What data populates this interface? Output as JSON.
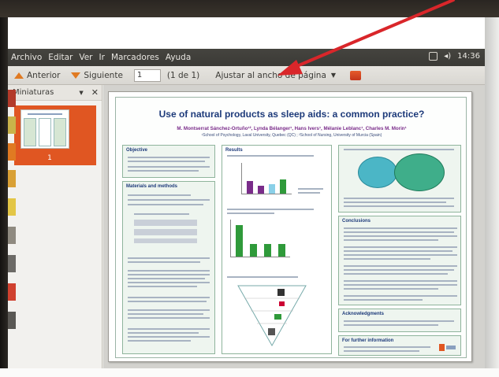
{
  "menubar": {
    "items": [
      "Archivo",
      "Editar",
      "Ver",
      "Ir",
      "Marcadores",
      "Ayuda"
    ],
    "clock": "14:36"
  },
  "toolbar": {
    "prev_label": "Anterior",
    "next_label": "Siguiente",
    "page_value": "1",
    "page_of": "(1 de 1)",
    "zoom_label": "Ajustar al ancho de página"
  },
  "sidebar": {
    "title": "Miniaturas",
    "thumbnail_page": "1"
  },
  "poster": {
    "title": "Use of natural products as sleep aids: a common practice?",
    "authors": "M. Montserrat Sánchez-Ortuño¹², Lynda Bélanger¹, Hans Ivers¹, Mélanie Leblanc¹, Charles M. Morin¹",
    "affiliations": "¹School of Psychology, Laval University, Quebec (QC) ; ²School of Nursing, University of Murcia (Spain)",
    "sections": {
      "objective": "Objective",
      "results": "Results",
      "materials": "Materials and methods",
      "conclusions": "Conclusions",
      "acknowledgments": "Acknowledgments",
      "further": "For further information"
    }
  },
  "colors": {
    "accent_orange": "#e05622",
    "annotation_arrow": "#d9262a",
    "poster_title": "#1d3a7a",
    "poster_authors": "#7a2c8a"
  },
  "icons": [
    "prev-arrow-icon",
    "next-arrow-icon",
    "bookmark-icon",
    "close-icon",
    "volume-icon",
    "keyboard-icon"
  ]
}
